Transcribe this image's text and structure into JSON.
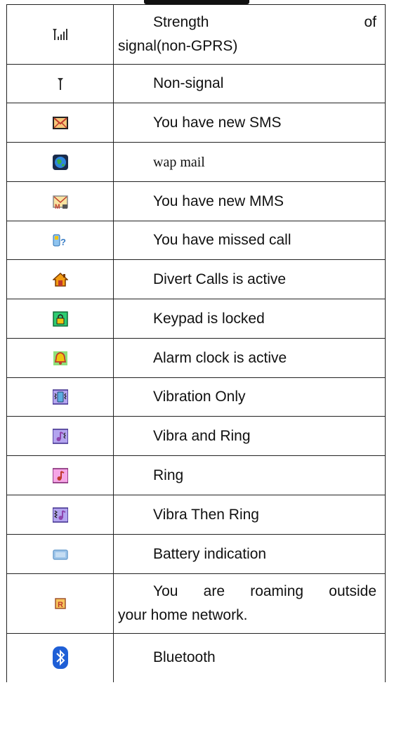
{
  "rows": [
    {
      "icon": "signal-strength-icon",
      "text_line1_a": "Strength",
      "text_line1_b": "of",
      "text_line2": "signal(non-GPRS)"
    },
    {
      "icon": "no-signal-icon",
      "text": "Non-signal"
    },
    {
      "icon": "sms-envelope-icon",
      "text": "You have new SMS"
    },
    {
      "icon": "wap-globe-icon",
      "text": "wap mail"
    },
    {
      "icon": "mms-envelope-icon",
      "text": "You have new MMS"
    },
    {
      "icon": "missed-call-icon",
      "text": "You have missed call"
    },
    {
      "icon": "divert-calls-icon",
      "text": "Divert Calls is active"
    },
    {
      "icon": "keypad-lock-icon",
      "text": "Keypad is locked"
    },
    {
      "icon": "alarm-bell-icon",
      "text": "Alarm clock is active"
    },
    {
      "icon": "vibration-icon",
      "text": "Vibration Only"
    },
    {
      "icon": "vibra-ring-icon",
      "text": "Vibra and Ring"
    },
    {
      "icon": "ring-icon",
      "text": "Ring"
    },
    {
      "icon": "vibra-then-ring-icon",
      "text": "Vibra Then Ring"
    },
    {
      "icon": "battery-icon",
      "text": "Battery indication"
    },
    {
      "icon": "roaming-icon",
      "text_line1_words": [
        "You",
        "are",
        "roaming",
        "outside"
      ],
      "text_line2": "your home network."
    },
    {
      "icon": "bluetooth-icon",
      "text": "Bluetooth"
    }
  ],
  "colors": {
    "border": "#222222",
    "text": "#111111"
  }
}
